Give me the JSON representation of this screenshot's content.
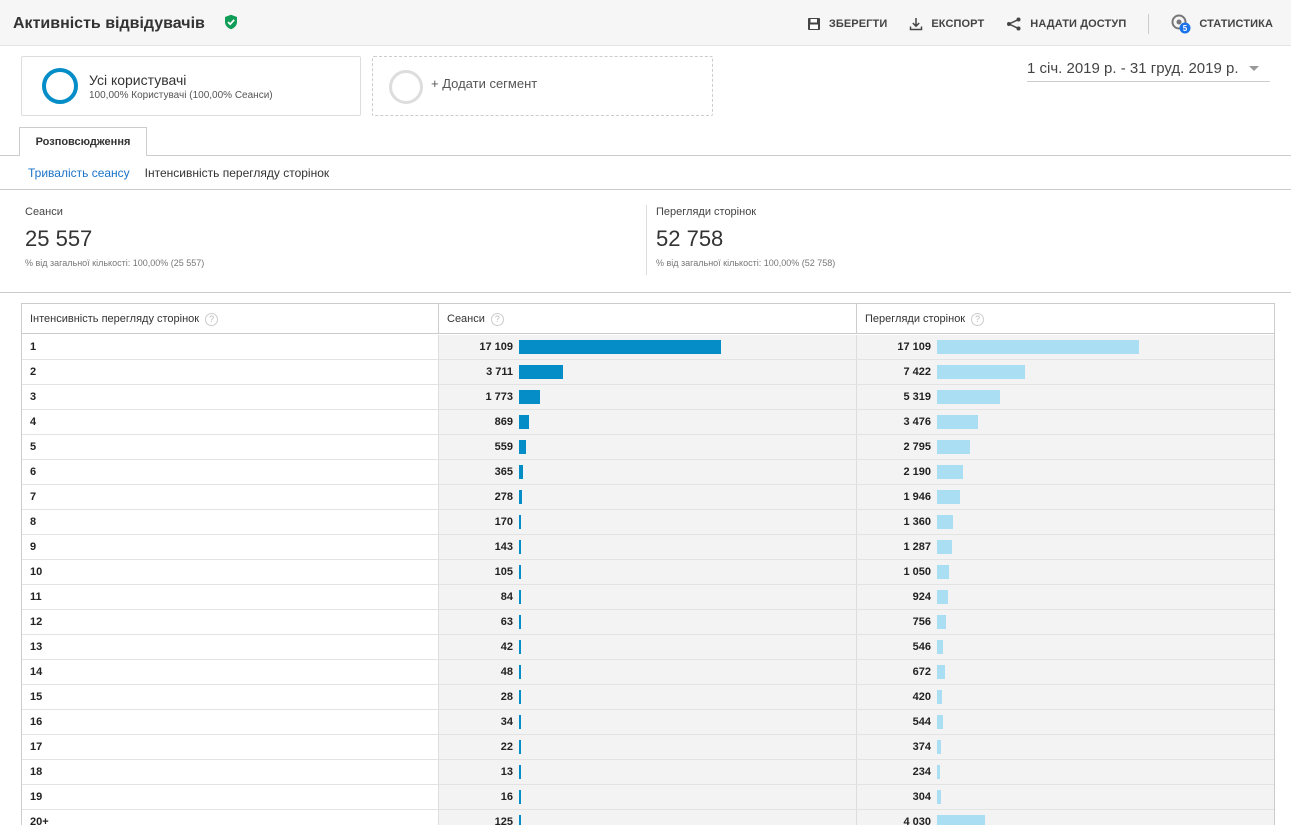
{
  "header": {
    "title": "Активність відвідувачів",
    "save_label": "ЗБЕРЕГТИ",
    "export_label": "ЕКСПОРТ",
    "share_label": "НАДАТИ ДОСТУП",
    "insights_label": "СТАТИСТИКА",
    "insights_badge": "5"
  },
  "segments": {
    "active": {
      "name": "Усі користувачі",
      "subtitle": "100,00% Користувачі (100,00% Сеанси)"
    },
    "add_label": "+ Додати сегмент"
  },
  "date_range": "1 січ. 2019 р. - 31 груд. 2019 р.",
  "tabs": [
    {
      "label": "Розповсюдження",
      "active": true
    }
  ],
  "subnav": {
    "link": "Тривалість сеансу",
    "current": "Інтенсивність перегляду сторінок"
  },
  "metrics": {
    "sessions": {
      "label": "Сеанси",
      "value": "25 557",
      "sub": "% від загальної кількості: 100,00% (25 557)"
    },
    "pageviews": {
      "label": "Перегляди сторінок",
      "value": "52 758",
      "sub": "% від загальної кількості: 100,00% (52 758)"
    }
  },
  "table": {
    "headers": [
      "Інтенсивність перегляду сторінок",
      "Сеанси",
      "Перегляди сторінок"
    ],
    "help_glyph": "?",
    "rows": [
      {
        "depth": "1",
        "sessions": "17 109",
        "pageviews": "17 109",
        "s": 17109,
        "p": 17109
      },
      {
        "depth": "2",
        "sessions": "3 711",
        "pageviews": "7 422",
        "s": 3711,
        "p": 7422
      },
      {
        "depth": "3",
        "sessions": "1 773",
        "pageviews": "5 319",
        "s": 1773,
        "p": 5319
      },
      {
        "depth": "4",
        "sessions": "869",
        "pageviews": "3 476",
        "s": 869,
        "p": 3476
      },
      {
        "depth": "5",
        "sessions": "559",
        "pageviews": "2 795",
        "s": 559,
        "p": 2795
      },
      {
        "depth": "6",
        "sessions": "365",
        "pageviews": "2 190",
        "s": 365,
        "p": 2190
      },
      {
        "depth": "7",
        "sessions": "278",
        "pageviews": "1 946",
        "s": 278,
        "p": 1946
      },
      {
        "depth": "8",
        "sessions": "170",
        "pageviews": "1 360",
        "s": 170,
        "p": 1360
      },
      {
        "depth": "9",
        "sessions": "143",
        "pageviews": "1 287",
        "s": 143,
        "p": 1287
      },
      {
        "depth": "10",
        "sessions": "105",
        "pageviews": "1 050",
        "s": 105,
        "p": 1050
      },
      {
        "depth": "11",
        "sessions": "84",
        "pageviews": "924",
        "s": 84,
        "p": 924
      },
      {
        "depth": "12",
        "sessions": "63",
        "pageviews": "756",
        "s": 63,
        "p": 756
      },
      {
        "depth": "13",
        "sessions": "42",
        "pageviews": "546",
        "s": 42,
        "p": 546
      },
      {
        "depth": "14",
        "sessions": "48",
        "pageviews": "672",
        "s": 48,
        "p": 672
      },
      {
        "depth": "15",
        "sessions": "28",
        "pageviews": "420",
        "s": 28,
        "p": 420
      },
      {
        "depth": "16",
        "sessions": "34",
        "pageviews": "544",
        "s": 34,
        "p": 544
      },
      {
        "depth": "17",
        "sessions": "22",
        "pageviews": "374",
        "s": 22,
        "p": 374
      },
      {
        "depth": "18",
        "sessions": "13",
        "pageviews": "234",
        "s": 13,
        "p": 234
      },
      {
        "depth": "19",
        "sessions": "16",
        "pageviews": "304",
        "s": 16,
        "p": 304
      },
      {
        "depth": "20+",
        "sessions": "125",
        "pageviews": "4 030",
        "s": 125,
        "p": 4030
      }
    ]
  },
  "colors": {
    "accent": "#058dc7",
    "sessions_bar": "#058dc7",
    "pageviews_bar": "#aadff3",
    "verified": "#0f9d58"
  },
  "icons": [
    "check-shield-icon",
    "save-icon",
    "download-icon",
    "share-icon",
    "insights-icon",
    "chevron-down-icon",
    "help-icon"
  ]
}
